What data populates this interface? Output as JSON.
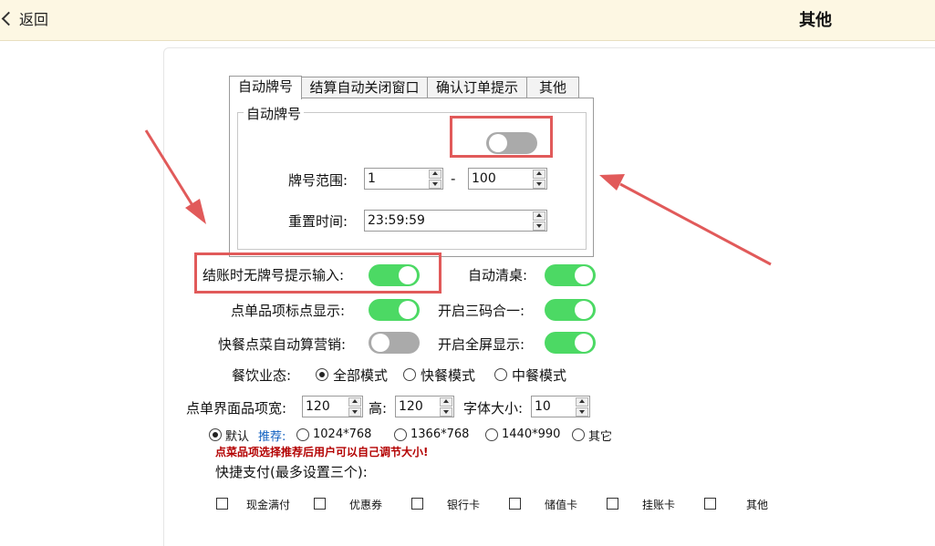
{
  "header": {
    "back_label": "返回",
    "title": "其他"
  },
  "tabs": [
    "自动牌号",
    "结算自动关闭窗口",
    "确认订单提示",
    "其他"
  ],
  "auto_number": {
    "group_title": "自动牌号",
    "enabled": false,
    "range_label": "牌号范围:",
    "range_from": "1",
    "range_separator": "-",
    "range_to": "100",
    "reset_label": "重置时间:",
    "reset_time": "23:59:59"
  },
  "toggles": [
    {
      "label": "结账时无牌号提示输入:",
      "on": true
    },
    {
      "label": "自动清桌:",
      "on": true
    },
    {
      "label": "点单品项标点显示:",
      "on": true
    },
    {
      "label": "开启三码合一:",
      "on": true
    },
    {
      "label": "快餐点菜自动算营销:",
      "on": false
    },
    {
      "label": "开启全屏显示:",
      "on": true
    }
  ],
  "dining_mode": {
    "label": "餐饮业态:",
    "options": [
      "全部模式",
      "快餐模式",
      "中餐模式"
    ],
    "selected": "全部模式"
  },
  "item_size": {
    "width_label": "点单界面品项宽:",
    "width": "120",
    "height_label": "高:",
    "height": "120",
    "font_label": "字体大小:",
    "font": "10"
  },
  "resolution": {
    "default_label": "默认",
    "recommend_label": "推荐:",
    "options": [
      "1024*768",
      "1366*768",
      "1440*990",
      "其它"
    ],
    "selected": "默认",
    "hint": "点菜品项选择推荐后用户可以自己调节大小!"
  },
  "quick_pay": {
    "label": "快捷支付(最多设置三个):",
    "options": [
      "现金满付",
      "优惠券",
      "银行卡",
      "储值卡",
      "挂账卡",
      "其他"
    ]
  },
  "colors": {
    "accent_green": "#4cd964",
    "highlight_red": "#e15a5a",
    "header_bg": "#fdf7e3",
    "warn_text": "#b30000"
  }
}
